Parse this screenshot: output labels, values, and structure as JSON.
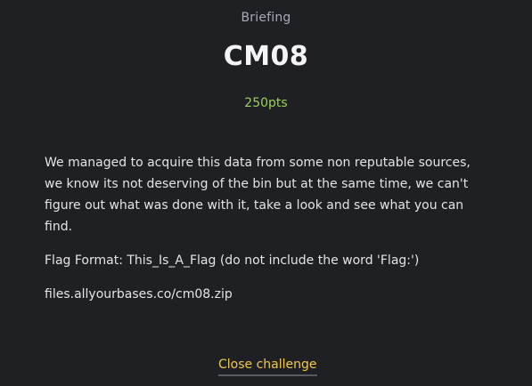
{
  "challenge": {
    "category": "Briefing",
    "title": "CM08",
    "points": "250pts",
    "description": "We managed to acquire this data from some non reputable sources, we know its not deserving of the bin but at the same time, we can't figure out what was done with it, take a look and see what you can find.",
    "flag_format": "Flag Format: This_Is_A_Flag (do not include the word 'Flag:')",
    "file_link": "files.allyourbases.co/cm08.zip"
  },
  "actions": {
    "close_label": "Close challenge"
  },
  "colors": {
    "background": "#1f2024",
    "points": "#9ccf59",
    "close_button": "#f1c84b"
  }
}
